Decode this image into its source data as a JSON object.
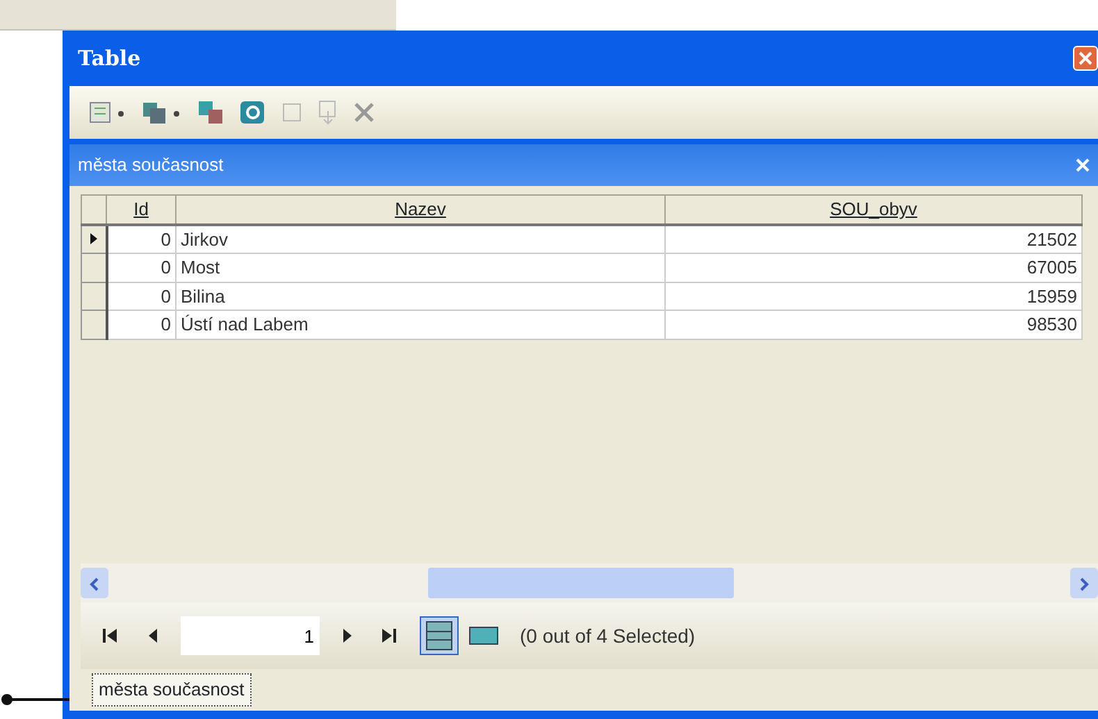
{
  "window": {
    "title": "Table"
  },
  "table_title": "města současnost",
  "table": {
    "columns": [
      "Id",
      "Nazev",
      "SOU_obyv"
    ],
    "rows": [
      {
        "current": true,
        "cells": [
          "0",
          "Jirkov",
          "21502"
        ]
      },
      {
        "current": false,
        "cells": [
          "0",
          "Most",
          "67005"
        ]
      },
      {
        "current": false,
        "cells": [
          "0",
          "Bilina",
          "15959"
        ]
      },
      {
        "current": false,
        "cells": [
          "0",
          "Ústí nad Labem",
          "98530"
        ]
      }
    ]
  },
  "navigation": {
    "record": "1",
    "status": "(0 out of 4 Selected)",
    "views": [
      {
        "kind": "all",
        "selected": true
      },
      {
        "kind": "selected",
        "selected": false
      }
    ]
  },
  "tabs": [
    {
      "label": "města současnost",
      "selected": true
    }
  ]
}
